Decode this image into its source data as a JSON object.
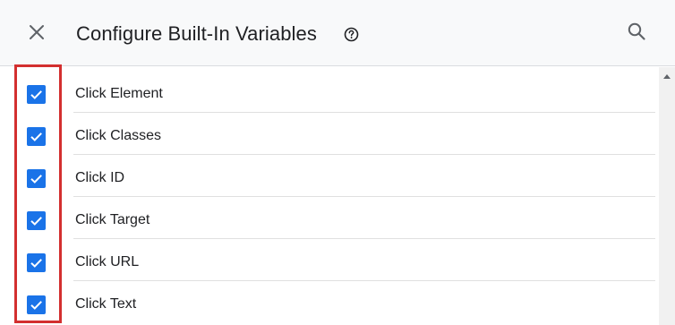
{
  "header": {
    "title": "Configure Built-In Variables",
    "close_icon": "close-icon",
    "help_icon": "help-circle-icon",
    "search_icon": "search-icon"
  },
  "variables": [
    {
      "label": "Click Element",
      "checked": true
    },
    {
      "label": "Click Classes",
      "checked": true
    },
    {
      "label": "Click ID",
      "checked": true
    },
    {
      "label": "Click Target",
      "checked": true
    },
    {
      "label": "Click URL",
      "checked": true
    },
    {
      "label": "Click Text",
      "checked": true
    }
  ],
  "colors": {
    "checkbox": "#1a73e8",
    "highlight": "#d32f2f",
    "header_bg": "#f8f9fa"
  }
}
